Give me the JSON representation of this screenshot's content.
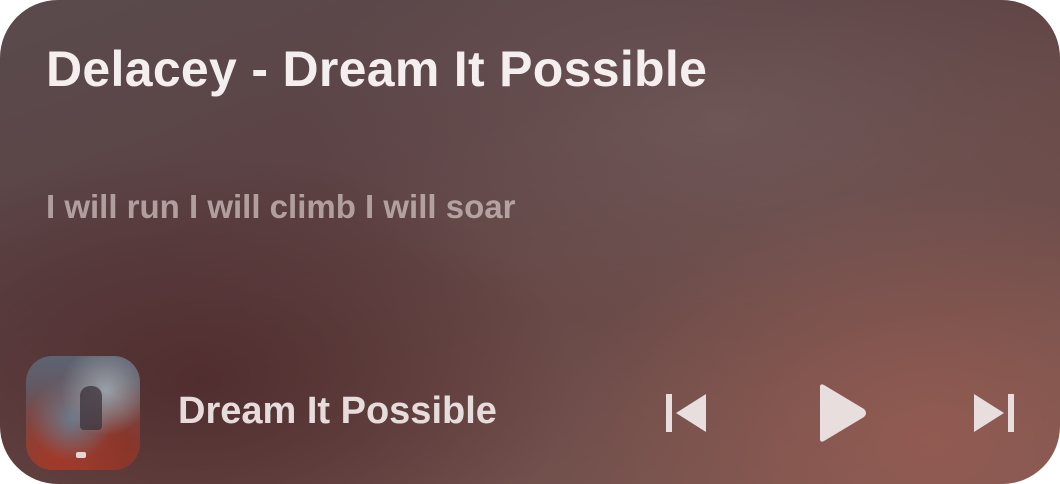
{
  "widget": {
    "title": "Delacey - Dream It Possible",
    "lyric": "I will run I will climb I will soar",
    "now_playing": {
      "song_title": "Dream It Possible",
      "album_art": "album-art-image"
    },
    "controls": {
      "previous": "previous-track-icon",
      "play": "play-icon",
      "next": "next-track-icon"
    }
  },
  "colors": {
    "text_primary": "#f4eeee",
    "text_secondary": "#d2c4c4",
    "icon": "#e8dede"
  }
}
